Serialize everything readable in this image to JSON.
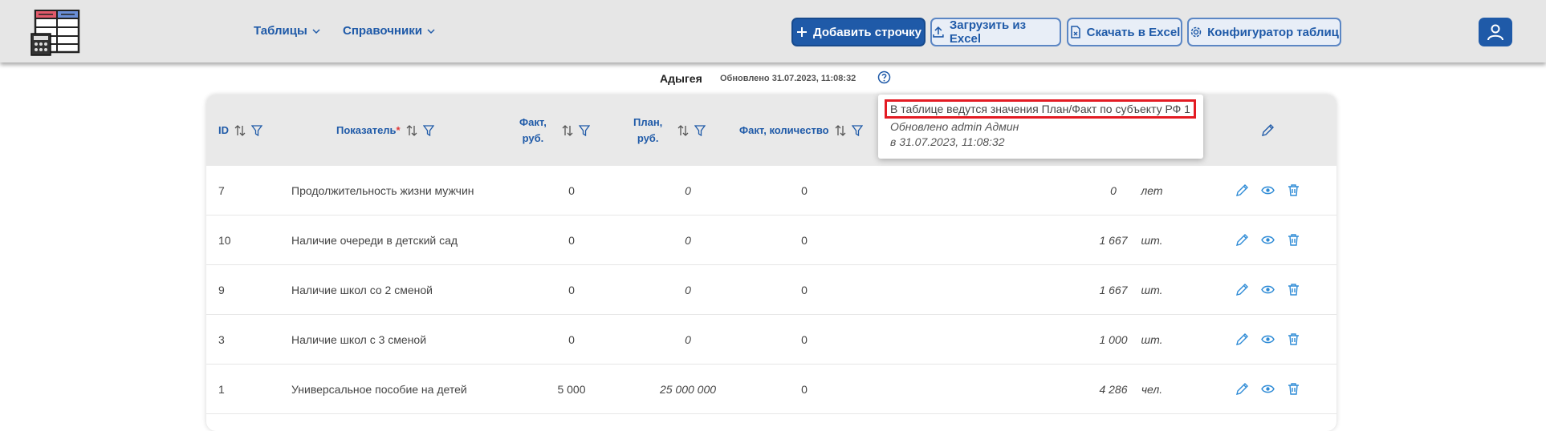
{
  "nav": {
    "tables": "Таблицы",
    "references": "Справочники"
  },
  "toolbar": {
    "add_row": "Добавить строчку",
    "upload_excel": "Загрузить из Excel",
    "download_excel": "Скачать в Excel",
    "configurator": "Конфигуратор таблиц"
  },
  "subheader": {
    "region": "Адыгея",
    "updated": "Обновлено 31.07.2023, 11:08:32"
  },
  "table": {
    "columns": {
      "id": "ID",
      "indicator": "Показатель",
      "fact_rub_1": "Факт,",
      "fact_rub_2": "руб.",
      "plan_rub_1": "План,",
      "plan_rub_2": "руб.",
      "fact_qty": "Факт, количество"
    },
    "rows": [
      {
        "id": "7",
        "name": "Продолжительность жизни мужчин",
        "fact": "0",
        "plan": "0",
        "fact_qty": "0",
        "plan_qty": "0",
        "unit": "лет"
      },
      {
        "id": "10",
        "name": "Наличие очереди в детский сад",
        "fact": "0",
        "plan": "0",
        "fact_qty": "0",
        "plan_qty": "1 667",
        "unit": "шт."
      },
      {
        "id": "9",
        "name": "Наличие школ со 2 сменой",
        "fact": "0",
        "plan": "0",
        "fact_qty": "0",
        "plan_qty": "1 667",
        "unit": "шт."
      },
      {
        "id": "3",
        "name": "Наличие школ с 3 сменой",
        "fact": "0",
        "plan": "0",
        "fact_qty": "0",
        "plan_qty": "1 000",
        "unit": "шт."
      },
      {
        "id": "1",
        "name": "Универсальное пособие на детей",
        "fact": "5 000",
        "plan": "25 000 000",
        "fact_qty": "0",
        "plan_qty": "4 286",
        "unit": "чел."
      }
    ]
  },
  "tooltip": {
    "main": "В таблице ведутся значения План/Факт по субъекту РФ 1",
    "updated_by": "Обновлено admin Админ",
    "updated_at": "в 31.07.2023, 11:08:32"
  },
  "colors": {
    "accent": "#1f5aa8",
    "highlight": "#e31b23",
    "header_bg": "#e6e6e6"
  }
}
